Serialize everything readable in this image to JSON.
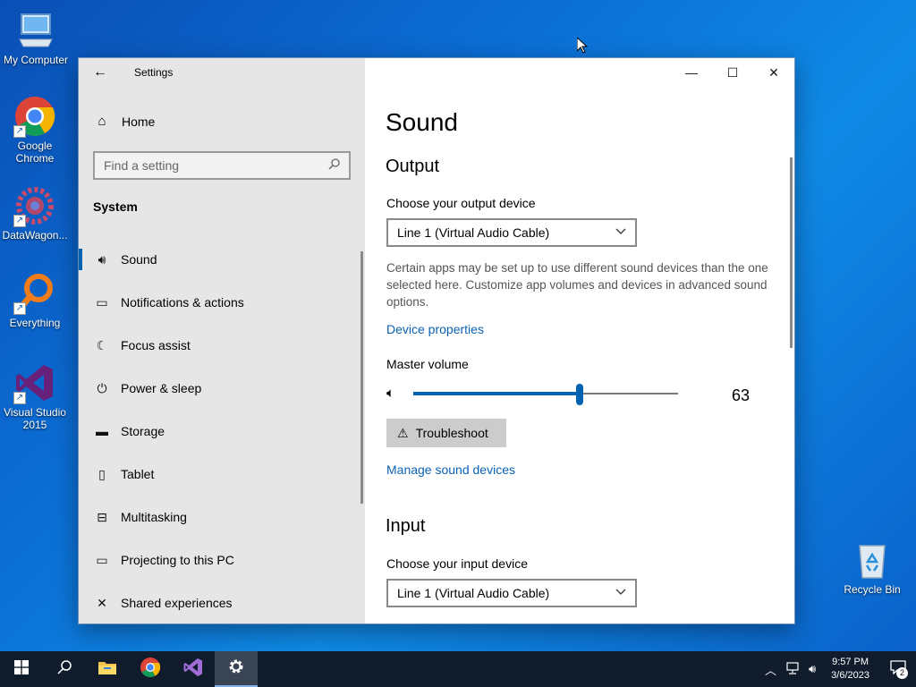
{
  "desktop": {
    "icons": [
      {
        "label": "My Computer"
      },
      {
        "label": "Google Chrome"
      },
      {
        "label": "DataWagon..."
      },
      {
        "label": "Everything"
      },
      {
        "label": "Visual Studio 2015"
      },
      {
        "label": "Recycle Bin"
      }
    ]
  },
  "window": {
    "title": "Settings",
    "controls": {
      "minimize": "—",
      "maximize": "☐",
      "close": "✕"
    }
  },
  "nav": {
    "home_label": "Home",
    "search_placeholder": "Find a setting",
    "section_title": "System",
    "items": [
      {
        "label": "Sound",
        "icon": "speaker-icon",
        "glyph": "🔊︎",
        "active": true
      },
      {
        "label": "Notifications & actions",
        "icon": "notification-icon",
        "glyph": "▭"
      },
      {
        "label": "Focus assist",
        "icon": "moon-icon",
        "glyph": "☾"
      },
      {
        "label": "Power & sleep",
        "icon": "power-icon",
        "glyph": "⏻"
      },
      {
        "label": "Storage",
        "icon": "storage-icon",
        "glyph": "▬"
      },
      {
        "label": "Tablet",
        "icon": "tablet-icon",
        "glyph": "▯"
      },
      {
        "label": "Multitasking",
        "icon": "multitasking-icon",
        "glyph": "⊟"
      },
      {
        "label": "Projecting to this PC",
        "icon": "projecting-icon",
        "glyph": "▭"
      },
      {
        "label": "Shared experiences",
        "icon": "shared-experiences-icon",
        "glyph": "✕"
      }
    ]
  },
  "main": {
    "page_title": "Sound",
    "output": {
      "heading": "Output",
      "device_label": "Choose your output device",
      "device_value": "Line 1 (Virtual Audio Cable)",
      "help_text": "Certain apps may be set up to use different sound devices than the one selected here. Customize app volumes and devices in advanced sound options.",
      "device_properties_link": "Device properties",
      "master_volume_label": "Master volume",
      "volume": 63,
      "volume_text": "63",
      "troubleshoot_label": "Troubleshoot",
      "manage_devices_link": "Manage sound devices"
    },
    "input": {
      "heading": "Input",
      "device_label": "Choose your input device",
      "device_value": "Line 1 (Virtual Audio Cable)"
    }
  },
  "taskbar": {
    "time": "9:57 PM",
    "date": "3/6/2023",
    "notification_count": "2"
  },
  "colors": {
    "accent": "#0063b1",
    "link": "#0b62b5",
    "taskbar": "#101b2b"
  }
}
